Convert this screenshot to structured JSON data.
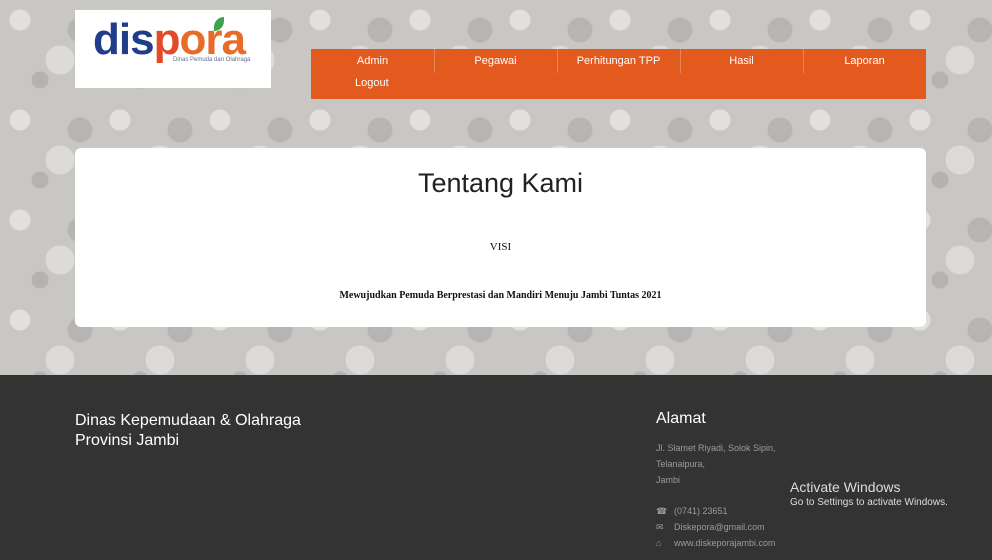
{
  "logo": {
    "part1": "dis",
    "part2": "p",
    "part3": "ora",
    "subtitle": "Dinas Pemuda dan Olahraga"
  },
  "nav": {
    "items": [
      "Admin",
      "Pegawai",
      "Perhitungan TPP",
      "Hasil",
      "Laporan"
    ],
    "logout": "Logout"
  },
  "card": {
    "title": "Tentang Kami",
    "visi_label": "VISI",
    "visi_text": "Mewujudkan Pemuda Berprestasi dan Mandiri Menuju Jambi Tuntas 2021"
  },
  "footer": {
    "org_line1": "Dinas Kepemudaan & Olahraga",
    "org_line2": "Provinsi Jambi",
    "address_title": "Alamat",
    "address_lines": [
      "Jl. Slamet Riyadi, Solok Sipin,",
      "Telanaipura,",
      "Jambi"
    ],
    "phone": "(0741) 23651",
    "email": "Diskepora@gmail.com",
    "website": "www.diskeporajambi.com"
  },
  "watermark": {
    "title": "Activate Windows",
    "subtitle": "Go to Settings to activate Windows."
  },
  "colors": {
    "nav_bg": "#e35a1f",
    "footer_bg": "#333333"
  }
}
